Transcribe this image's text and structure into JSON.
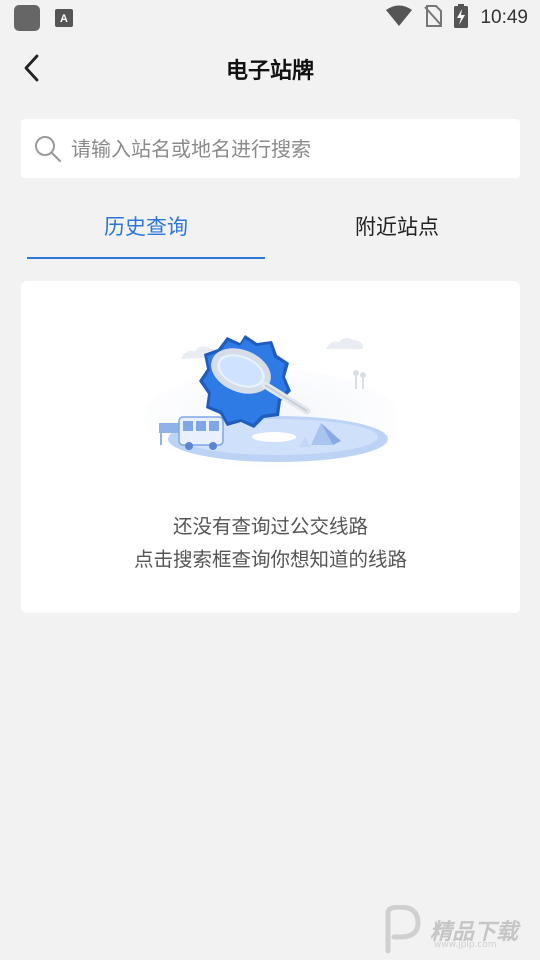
{
  "status_bar": {
    "time": "10:49",
    "icons": [
      "app-icon",
      "a-notification-icon",
      "wifi-icon",
      "no-sim-icon",
      "battery-charging-icon"
    ]
  },
  "header": {
    "title": "电子站牌",
    "back_icon": "chevron-left-icon"
  },
  "search": {
    "placeholder": "请输入站名或地名进行搜索",
    "value": ""
  },
  "tabs": [
    {
      "label": "历史查询",
      "active": true
    },
    {
      "label": "附近站点",
      "active": false
    }
  ],
  "empty_state": {
    "illustration": "magnifier-badge-bus-illustration",
    "line1": "还没有查询过公交线路",
    "line2": "点击搜索框查询你想知道的线路"
  },
  "watermark": {
    "text": "精品下载",
    "sub": "www.jplp.com"
  },
  "colors": {
    "accent": "#2d77d9",
    "background": "#f2f2f2",
    "card": "#ffffff"
  }
}
